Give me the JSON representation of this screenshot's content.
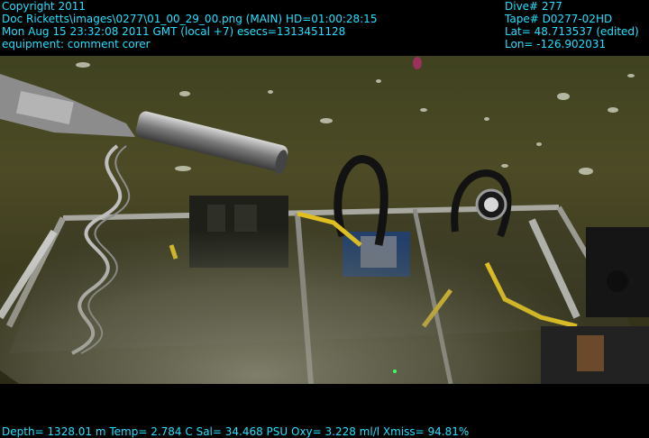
{
  "overlay": {
    "top_left": [
      "Copyright 2011",
      "Doc Ricketts\\images\\0277\\01_00_29_00.png (MAIN)  HD=01:00:28:15",
      "Mon Aug 15 23:32:08 2011 GMT (local +7)  esecs=1313451128",
      "equipment: comment corer"
    ],
    "top_right": [
      "Dive# 277",
      "Tape# D0277-02HD",
      "Lat= 48.713537 (edited)",
      "Lon= -126.902031"
    ],
    "bottom": "Depth= 1328.01 m  Temp= 2.784 C  Sal= 34.468 PSU  Oxy= 3.228 ml/l  Xmiss= 94.81%"
  },
  "colors": {
    "overlay_text": "#22e0ff",
    "seafloor": "#4a4a24",
    "background": "#000000"
  }
}
